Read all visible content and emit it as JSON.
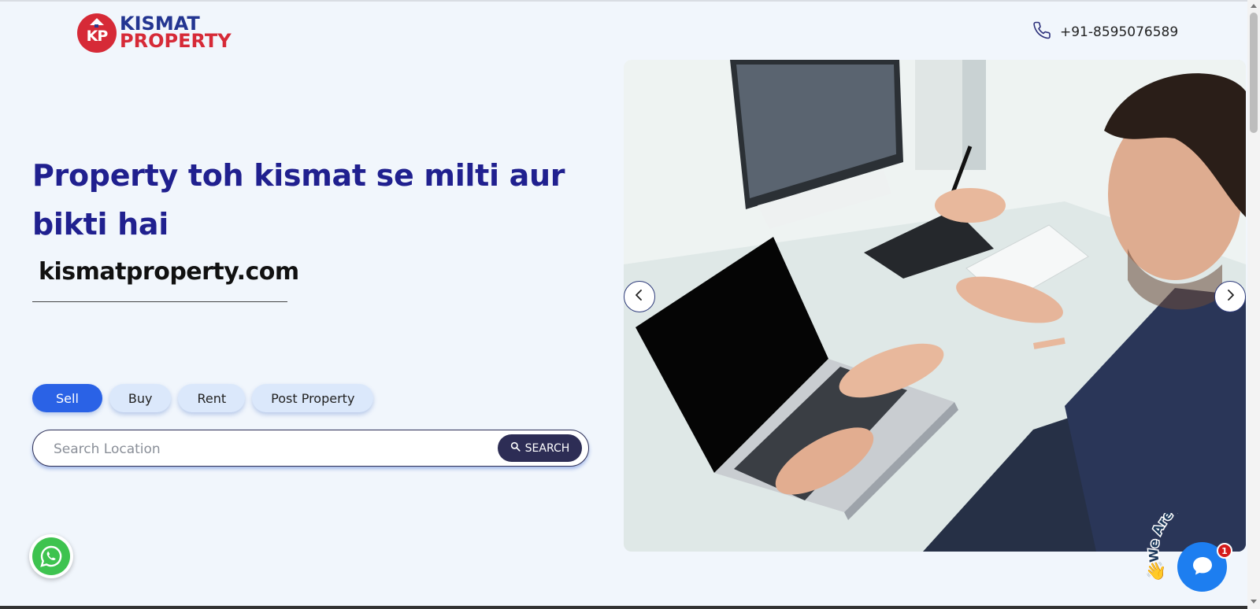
{
  "header": {
    "logo": {
      "badge_text": "KP",
      "line1": "KISMAT",
      "line2": "PROPERTY"
    },
    "phone": {
      "icon": "phone-icon",
      "number": "+91-8595076589"
    }
  },
  "hero": {
    "title": "Property toh kismat se milti aur bikti hai",
    "site": "kismatproperty.com"
  },
  "tabs": [
    {
      "label": "Sell",
      "active": true
    },
    {
      "label": "Buy",
      "active": false
    },
    {
      "label": "Rent",
      "active": false
    },
    {
      "label": "Post Property",
      "active": false
    }
  ],
  "search": {
    "placeholder": "Search Location",
    "value": "",
    "button_label": "SEARCH",
    "button_icon": "search-icon"
  },
  "carousel": {
    "image_description": "man-working-on-laptop-at-desk",
    "prev_icon": "chevron-left-icon",
    "next_icon": "chevron-right-icon"
  },
  "floating": {
    "whatsapp_icon": "whatsapp-icon",
    "chat": {
      "caption": "We Are Here!",
      "badge": "1",
      "icon": "chat-bubble-icon"
    }
  },
  "colors": {
    "brand_blue": "#20208f",
    "brand_red": "#d62a37",
    "tab_active": "#2a62e6",
    "tab_inactive": "#dbe8fb",
    "search_button": "#2d2d55",
    "background": "#f1f6fc",
    "whatsapp": "#3ec34f",
    "chat": "#1d7ef0"
  }
}
